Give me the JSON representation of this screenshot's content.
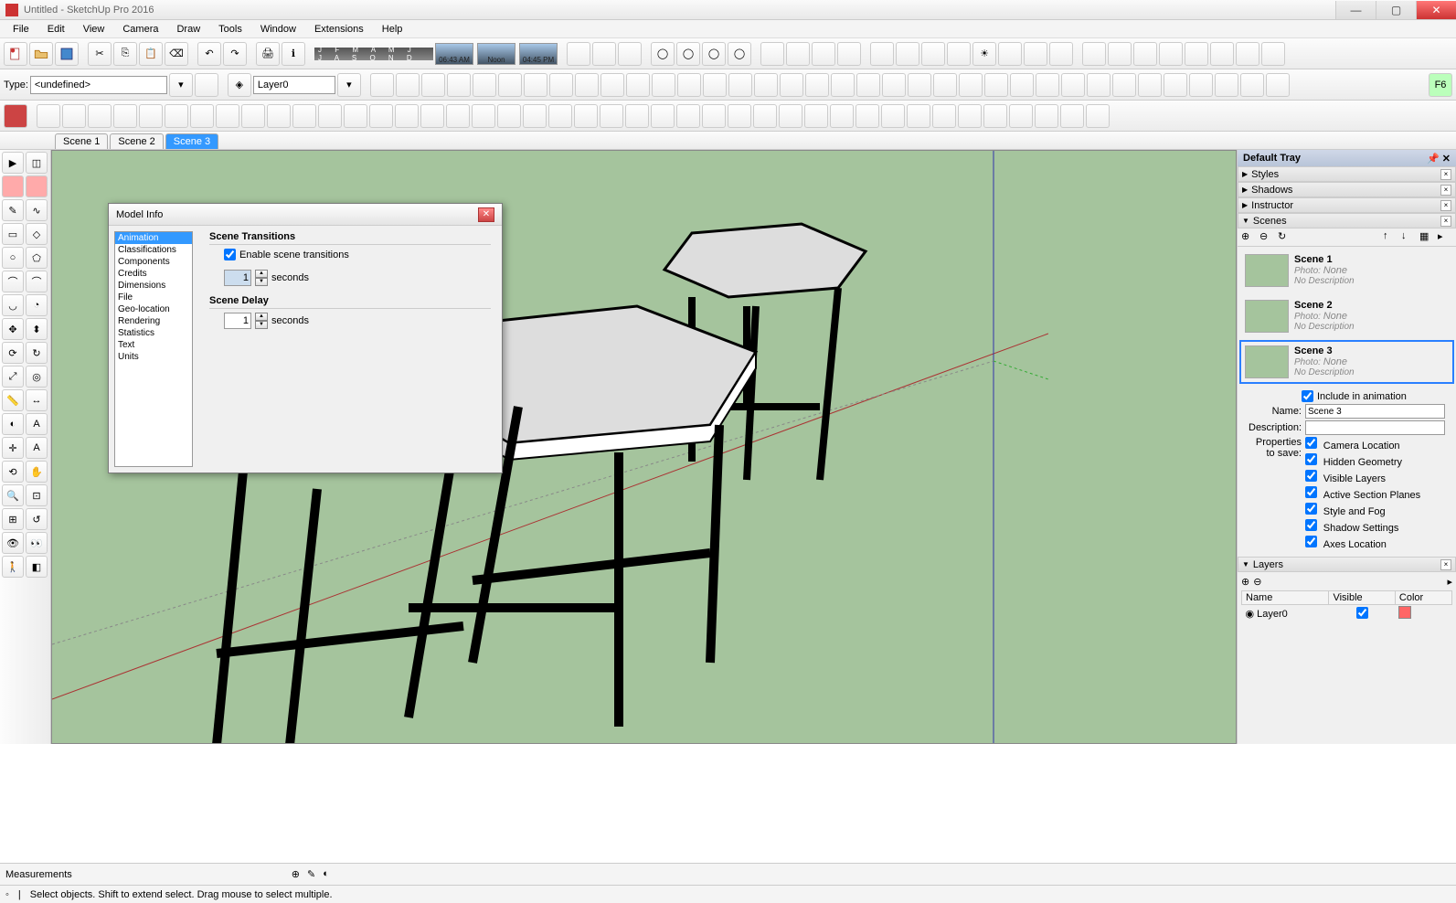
{
  "window": {
    "title": "Untitled - SketchUp Pro 2016"
  },
  "menus": [
    "File",
    "Edit",
    "View",
    "Camera",
    "Draw",
    "Tools",
    "Window",
    "Extensions",
    "Help"
  ],
  "type_label": "Type:",
  "type_value": "<undefined>",
  "layer_value": "Layer0",
  "months": "J F M A M J J A S O N D",
  "times": [
    "06:43 AM",
    "Noon",
    "04:45 PM"
  ],
  "scene_tabs": [
    "Scene 1",
    "Scene 2",
    "Scene 3"
  ],
  "active_scene_tab": 2,
  "tray": {
    "title": "Default Tray",
    "sections": {
      "styles": "Styles",
      "shadows": "Shadows",
      "instructor": "Instructor",
      "scenes": "Scenes",
      "layers": "Layers"
    }
  },
  "scenes_list": [
    {
      "name": "Scene 1",
      "photo_label": "Photo:",
      "photo_val": "None",
      "desc": "No Description"
    },
    {
      "name": "Scene 2",
      "photo_label": "Photo:",
      "photo_val": "None",
      "desc": "No Description"
    },
    {
      "name": "Scene 3",
      "photo_label": "Photo:",
      "photo_val": "None",
      "desc": "No Description"
    }
  ],
  "scene_form": {
    "include_label": "Include in animation",
    "name_label": "Name:",
    "name_value": "Scene 3",
    "desc_label": "Description:",
    "desc_value": "",
    "props_label1": "Properties",
    "props_label2": "to save:",
    "props": [
      "Camera Location",
      "Hidden Geometry",
      "Visible Layers",
      "Active Section Planes",
      "Style and Fog",
      "Shadow Settings",
      "Axes Location"
    ]
  },
  "layers": {
    "cols": [
      "Name",
      "Visible",
      "Color"
    ],
    "rows": [
      {
        "name": "Layer0"
      }
    ]
  },
  "status": {
    "measurements": "Measurements",
    "hint": "Select objects. Shift to extend select. Drag mouse to select multiple."
  },
  "dialog": {
    "title": "Model Info",
    "list": [
      "Animation",
      "Classifications",
      "Components",
      "Credits",
      "Dimensions",
      "File",
      "Geo-location",
      "Rendering",
      "Statistics",
      "Text",
      "Units"
    ],
    "selected": 0,
    "transitions_hdr": "Scene Transitions",
    "enable_label": "Enable scene transitions",
    "trans_seconds": "1",
    "seconds_label": "seconds",
    "delay_hdr": "Scene Delay",
    "delay_seconds": "1"
  }
}
